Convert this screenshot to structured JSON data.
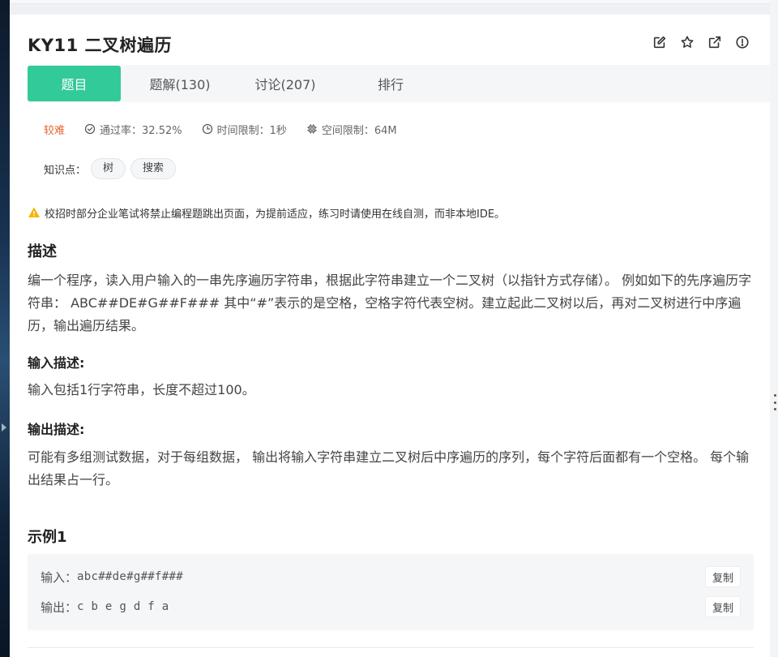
{
  "header": {
    "title": "KY11  二叉树遍历"
  },
  "header_icons": [
    "edit-icon",
    "star-icon",
    "external-link-icon",
    "info-icon"
  ],
  "tabs": [
    {
      "label": "题目"
    },
    {
      "label": "题解(130)"
    },
    {
      "label": "讨论(207)"
    },
    {
      "label": "排行"
    }
  ],
  "meta": {
    "difficulty": "较难",
    "pass_rate": "通过率：32.52%",
    "time_limit": "时间限制：1秒",
    "memory_limit": "空间限制：64M"
  },
  "knowledge": {
    "label": "知识点：",
    "tags": [
      "树",
      "搜索"
    ]
  },
  "notice": "校招时部分企业笔试将禁止编程题跳出页面，为提前适应，练习时请使用在线自测，而非本地IDE。",
  "description": {
    "heading": "描述",
    "text": "编一个程序，读入用户输入的一串先序遍历字符串，根据此字符串建立一个二叉树（以指针方式存储）。 例如如下的先序遍历字符串： ABC##DE#G##F### 其中“#”表示的是空格，空格字符代表空树。建立起此二叉树以后，再对二叉树进行中序遍历，输出遍历结果。"
  },
  "input_desc": {
    "heading": "输入描述:",
    "text": "输入包括1行字符串，长度不超过100。"
  },
  "output_desc": {
    "heading": "输出描述:",
    "text": "可能有多组测试数据，对于每组数据， 输出将输入字符串建立二叉树后中序遍历的序列，每个字符后面都有一个空格。 每个输出结果占一行。"
  },
  "example": {
    "heading": "示例1",
    "input_label": "输入：",
    "input_value": "abc##de#g##f###",
    "output_label": "输出：",
    "output_value": "c b e g d f a",
    "copy_label": "复制"
  },
  "colors": {
    "accent": "#32ca99",
    "difficulty": "#e7652d",
    "warning": "#f5b400"
  }
}
